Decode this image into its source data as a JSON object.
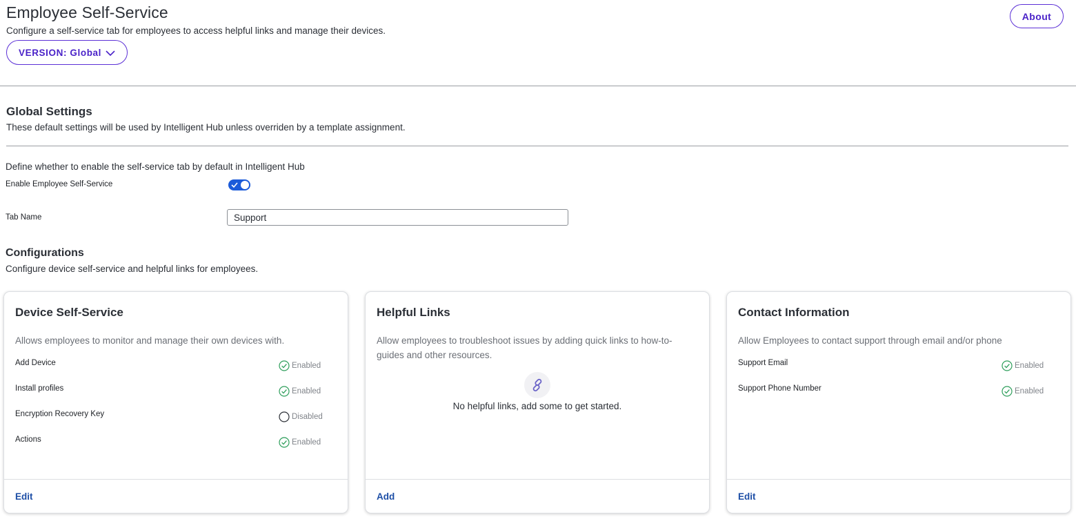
{
  "header": {
    "title": "Employee Self-Service",
    "subtitle": "Configure a self-service tab for employees to access helpful links and manage their devices.",
    "version_label": "VERSION: Global",
    "about_label": "About"
  },
  "global_settings": {
    "title": "Global Settings",
    "description": "These default settings will be used by Intelligent Hub unless overriden by a template assignment.",
    "define_text": "Define whether to enable the self-service tab by default in Intelligent Hub",
    "enable_label": "Enable Employee Self-Service",
    "enable_value": true,
    "tab_name_label": "Tab Name",
    "tab_name_value": "Support"
  },
  "configurations": {
    "title": "Configurations",
    "description": "Configure device self-service and helpful links for employees."
  },
  "cards": {
    "device": {
      "title": "Device Self-Service",
      "description": "Allows employees to monitor and manage their own devices with.",
      "rows": [
        {
          "label": "Add Device",
          "status": "Enabled"
        },
        {
          "label": "Install profiles",
          "status": "Enabled"
        },
        {
          "label": "Encryption Recovery Key",
          "status": "Disabled"
        },
        {
          "label": "Actions",
          "status": "Enabled"
        }
      ],
      "action": "Edit"
    },
    "links": {
      "title": "Helpful Links",
      "description": "Allow employees to troubleshoot issues by adding quick links to how-to-guides and other resources.",
      "empty_text": "No helpful links, add some to get started.",
      "action": "Add"
    },
    "contact": {
      "title": "Contact Information",
      "description": "Allow Employees to contact support through email and/or phone",
      "rows": [
        {
          "label": "Support Email",
          "status": "Enabled"
        },
        {
          "label": "Support Phone Number",
          "status": "Enabled"
        }
      ],
      "action": "Edit"
    }
  },
  "colors": {
    "accent_purple": "#5b2fd6",
    "toggle_blue": "#1c5bd9",
    "enabled_green": "#2e9e5b",
    "link_blue": "#1d4ea6"
  },
  "icons": {
    "version_dropdown": "chevron-down-icon",
    "toggle_check": "check-icon",
    "enabled": "check-circle-icon",
    "disabled": "empty-circle-icon",
    "empty_links": "link-icon"
  }
}
